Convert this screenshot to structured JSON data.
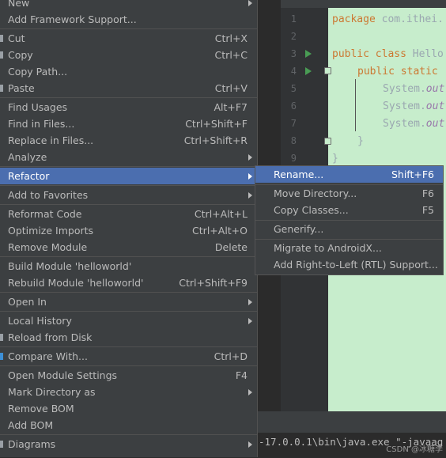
{
  "editor": {
    "line_numbers": [
      "1",
      "2",
      "3",
      "4",
      "5",
      "6",
      "7",
      "8",
      "9"
    ],
    "code": {
      "l1_kw": "package ",
      "l1_rest": "com.ithei.",
      "l3_kw": "public class ",
      "l3_rest": "Hello",
      "l4_kw": "public static",
      "l5": "System.",
      "l5_out": "out",
      "l6": "System.",
      "l6_out": "out",
      "l7": "System.",
      "l7_out": "out",
      "l8": "}",
      "l9": "}"
    },
    "background_color": "#c7edcc"
  },
  "console": {
    "text": "-17.0.0.1\\bin\\java.exe \"-javaag"
  },
  "watermark": "CSDN @冰糖李",
  "context_menu": {
    "new": "New",
    "add_framework": "Add Framework Support...",
    "cut": "Cut",
    "cut_sc": "Ctrl+X",
    "copy": "Copy",
    "copy_sc": "Ctrl+C",
    "copy_path": "Copy Path...",
    "paste": "Paste",
    "paste_sc": "Ctrl+V",
    "find_usages": "Find Usages",
    "find_usages_sc": "Alt+F7",
    "find_in_files": "Find in Files...",
    "find_in_files_sc": "Ctrl+Shift+F",
    "replace_in_files": "Replace in Files...",
    "replace_in_files_sc": "Ctrl+Shift+R",
    "analyze": "Analyze",
    "refactor": "Refactor",
    "add_to_favorites": "Add to Favorites",
    "reformat_code": "Reformat Code",
    "reformat_code_sc": "Ctrl+Alt+L",
    "optimize_imports": "Optimize Imports",
    "optimize_imports_sc": "Ctrl+Alt+O",
    "remove_module": "Remove Module",
    "remove_module_sc": "Delete",
    "build_module": "Build Module 'helloworld'",
    "rebuild_module": "Rebuild Module 'helloworld'",
    "rebuild_module_sc": "Ctrl+Shift+F9",
    "open_in": "Open In",
    "local_history": "Local History",
    "reload_from_disk": "Reload from Disk",
    "compare_with": "Compare With...",
    "compare_with_sc": "Ctrl+D",
    "open_module_settings": "Open Module Settings",
    "open_module_settings_sc": "F4",
    "mark_directory_as": "Mark Directory as",
    "remove_bom": "Remove BOM",
    "add_bom": "Add BOM",
    "diagrams": "Diagrams"
  },
  "refactor_submenu": {
    "rename": "Rename...",
    "rename_sc": "Shift+F6",
    "move_directory": "Move Directory...",
    "move_directory_sc": "F6",
    "copy_classes": "Copy Classes...",
    "copy_classes_sc": "F5",
    "generify": "Generify...",
    "migrate_androidx": "Migrate to AndroidX...",
    "add_rtl": "Add Right-to-Left (RTL) Support..."
  },
  "colors": {
    "menu_bg": "#3c3f41",
    "selection": "#4b6eaf",
    "text": "#bbbbbb",
    "separator": "#515151"
  }
}
